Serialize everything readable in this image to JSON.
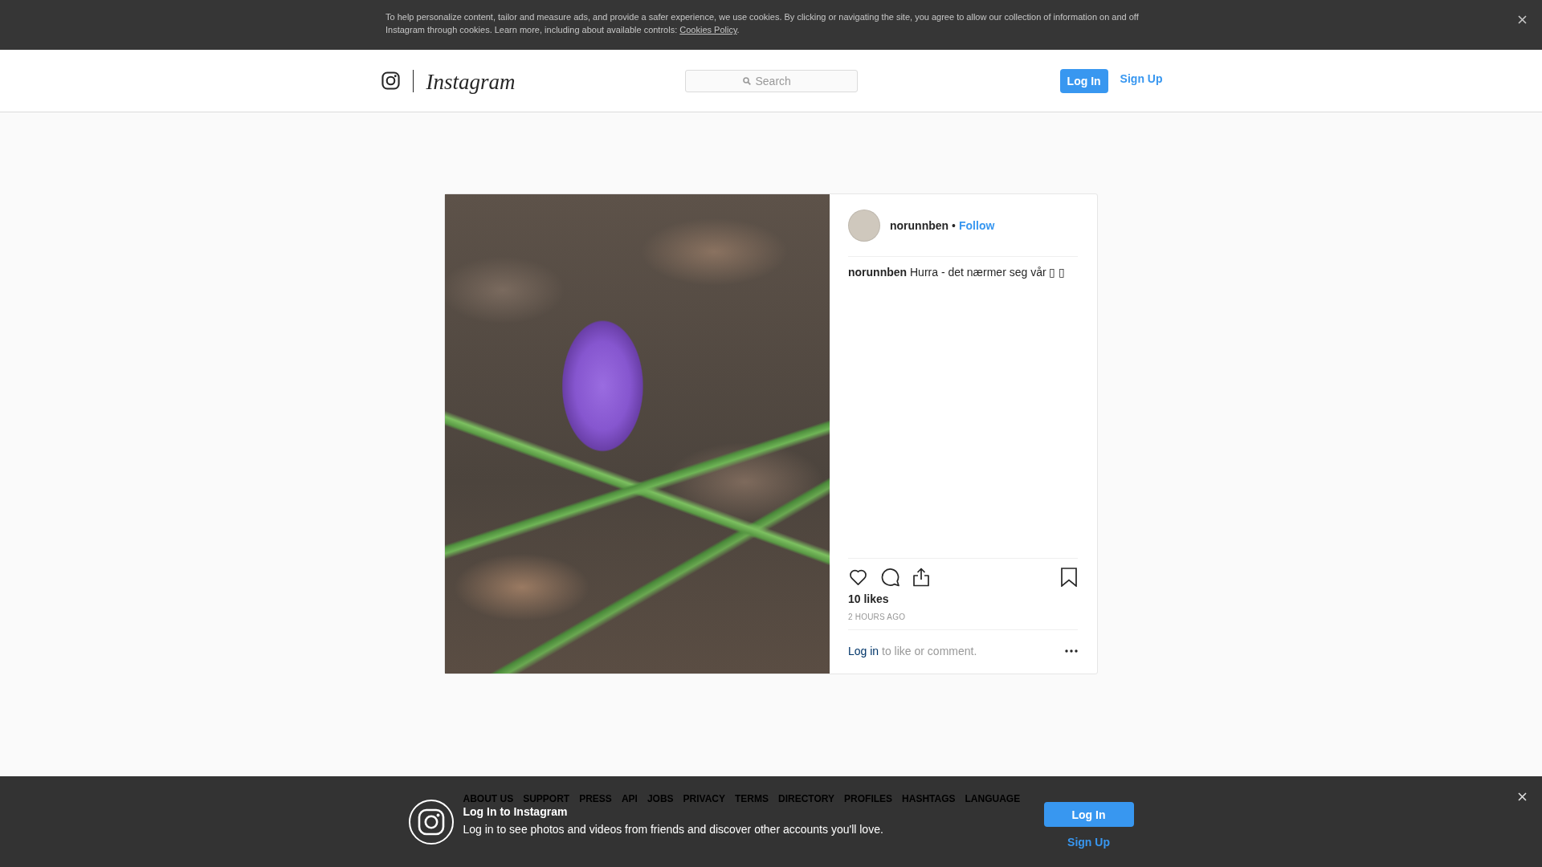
{
  "cookie_banner": {
    "text": "To help personalize content, tailor and measure ads, and provide a safer experience, we use cookies. By clicking or navigating the site, you agree to allow our collection of information on and off Instagram through cookies. Learn more, including about available controls:",
    "link": "Cookies Policy",
    "end": "."
  },
  "header": {
    "logo_text": "Instagram",
    "search": {
      "placeholder": "Search"
    },
    "buttons": [
      {
        "label": "Log In",
        "kind": "primary"
      },
      {
        "label": "Sign Up",
        "kind": "link"
      }
    ]
  },
  "post": {
    "author": "norunnben",
    "separator": "•",
    "follow": "Follow",
    "caption": "**norunnben** Hurra - det nærmer seg vår ▯ ▯",
    "likes": "10 likes",
    "time": "2 HOURS AGO",
    "login_prompt": {
      "link": "Log in",
      "text": "to like or comment."
    }
  },
  "footer": {
    "links": [
      "ABOUT US",
      "SUPPORT",
      "PRESS",
      "API",
      "JOBS",
      "PRIVACY",
      "TERMS",
      "DIRECTORY",
      "PROFILES",
      "HASHTAGS",
      "LANGUAGE"
    ]
  },
  "login_banner": {
    "title": "Log In to Instagram",
    "text": "Log in to see photos and videos from friends and discover other accounts you'll love.",
    "buttons": [
      {
        "label": "Log In",
        "kind": "primary"
      },
      {
        "label": "Sign Up",
        "kind": "link"
      }
    ]
  }
}
